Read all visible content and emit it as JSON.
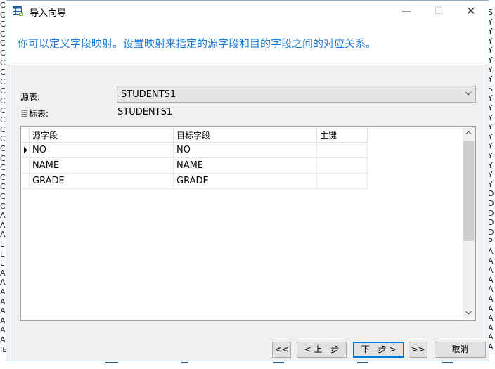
{
  "window": {
    "title": "导入向导",
    "minimize_glyph": "—",
    "maximize_glyph": "☐",
    "close_glyph": "✕"
  },
  "instruction": "你可以定义字段映射。设置映射来指定的源字段和目的字段之间的对应关系。",
  "source": {
    "label": "源表:",
    "selected": "STUDENTS1"
  },
  "target": {
    "label": "目标表:",
    "value": "STUDENTS1"
  },
  "grid": {
    "columns": [
      "源字段",
      "目标字段",
      "主键"
    ],
    "rows": [
      [
        "NO",
        "NO",
        ""
      ],
      [
        "NAME",
        "NAME",
        ""
      ],
      [
        "GRADE",
        "GRADE",
        ""
      ]
    ],
    "current_row": 0
  },
  "buttons": {
    "first": "<<",
    "prev": "< 上一步",
    "next": "下一步 >",
    "last": ">>",
    "cancel": "取消"
  },
  "background_edge": {
    "left_chars": [
      "C",
      "C",
      "C",
      "C",
      "C",
      "C",
      "C",
      "C",
      "C",
      "C",
      "C",
      "C",
      "C",
      "C",
      "C",
      "C",
      "C",
      "C",
      "C",
      "C",
      "C",
      "C",
      "A",
      "A",
      "A",
      "L",
      "L",
      "L",
      "A",
      "A",
      "A",
      "A",
      "A",
      "A",
      "A",
      "A",
      "IE"
    ],
    "right_chars": [
      "S",
      "Y",
      "Y",
      "Y",
      "Y",
      "Y",
      "Y",
      "Y",
      "S",
      "Y",
      "Y",
      "Y",
      "Y",
      "Y",
      "Y",
      "Y",
      "Y",
      "Y",
      "Y",
      "D",
      "D",
      "D",
      "D",
      "D",
      "P",
      "A",
      "A",
      "A",
      "A",
      "A",
      "A",
      "A",
      "A",
      "A",
      "A",
      "A"
    ]
  },
  "colors": {
    "instruction": "#1c7bd6",
    "dialog_bg": "#f0f0f0",
    "primary_border": "#0078d7"
  }
}
